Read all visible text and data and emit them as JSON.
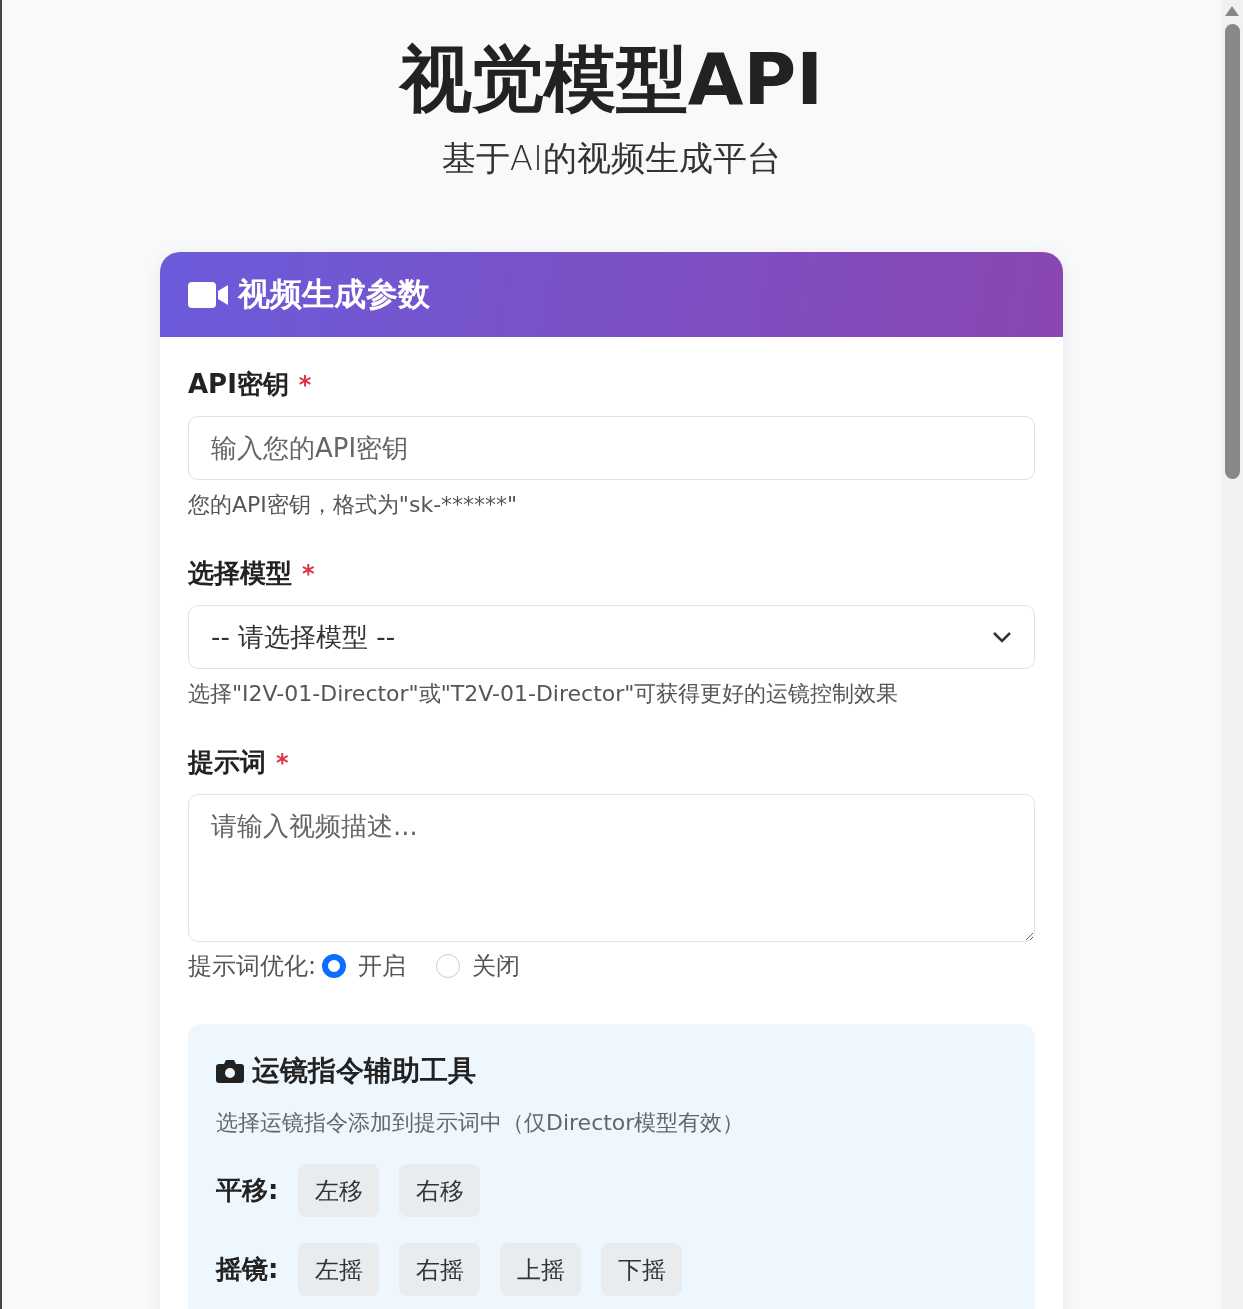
{
  "header": {
    "title": "视觉模型API",
    "subtitle": "基于AI的视频生成平台"
  },
  "card": {
    "title": "视频生成参数",
    "api_key": {
      "label": "API密钥",
      "required_mark": "*",
      "placeholder": "输入您的API密钥",
      "help": "您的API密钥，格式为\"sk-******\""
    },
    "model": {
      "label": "选择模型",
      "required_mark": "*",
      "value": "-- 请选择模型 --",
      "help": "选择\"I2V-01-Director\"或\"T2V-01-Director\"可获得更好的运镜控制效果"
    },
    "prompt": {
      "label": "提示词",
      "required_mark": "*",
      "placeholder": "请输入视频描述..."
    },
    "optimize": {
      "label": "提示词优化:",
      "options": [
        {
          "label": "开启",
          "selected": true
        },
        {
          "label": "关闭",
          "selected": false
        }
      ]
    },
    "camera_tools": {
      "title": "运镜指令辅助工具",
      "description": "选择运镜指令添加到提示词中（仅Director模型有效）",
      "groups": [
        {
          "label": "平移:",
          "buttons": [
            "左移",
            "右移"
          ]
        },
        {
          "label": "摇镜:",
          "buttons": [
            "左摇",
            "右摇",
            "上摇",
            "下摇"
          ]
        }
      ]
    }
  }
}
